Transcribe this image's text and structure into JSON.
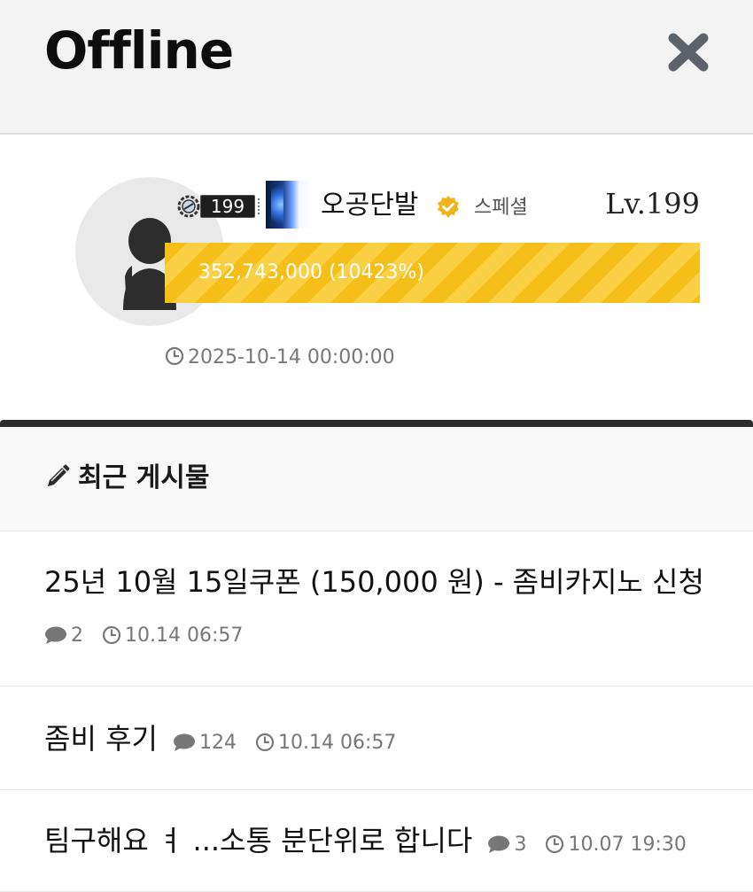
{
  "header": {
    "title": "Offline"
  },
  "profile": {
    "level_badge": "199",
    "username": "오공단발",
    "grade": "스페셜",
    "level": "Lv.199",
    "xp_text": "352,743,000 (10423%)",
    "xp_fill_percent": 100,
    "joined": "2025-10-14 00:00:00"
  },
  "recent_posts": {
    "title": "최근 게시물",
    "items": [
      {
        "title": "25년 10월 15일쿠폰 (150,000 원) - 좀비카지노 신청",
        "comments": "2",
        "time": "10.14 06:57"
      },
      {
        "title": "좀비 후기",
        "comments": "124",
        "time": "10.14 06:57"
      },
      {
        "title": "팀구해요 ㅕ ...소통 분단위로 합니다",
        "comments": "3",
        "time": "10.07 19:30"
      }
    ]
  },
  "colors": {
    "xp_bar": "#f6be18",
    "accent_badge": "#f1b31c"
  }
}
